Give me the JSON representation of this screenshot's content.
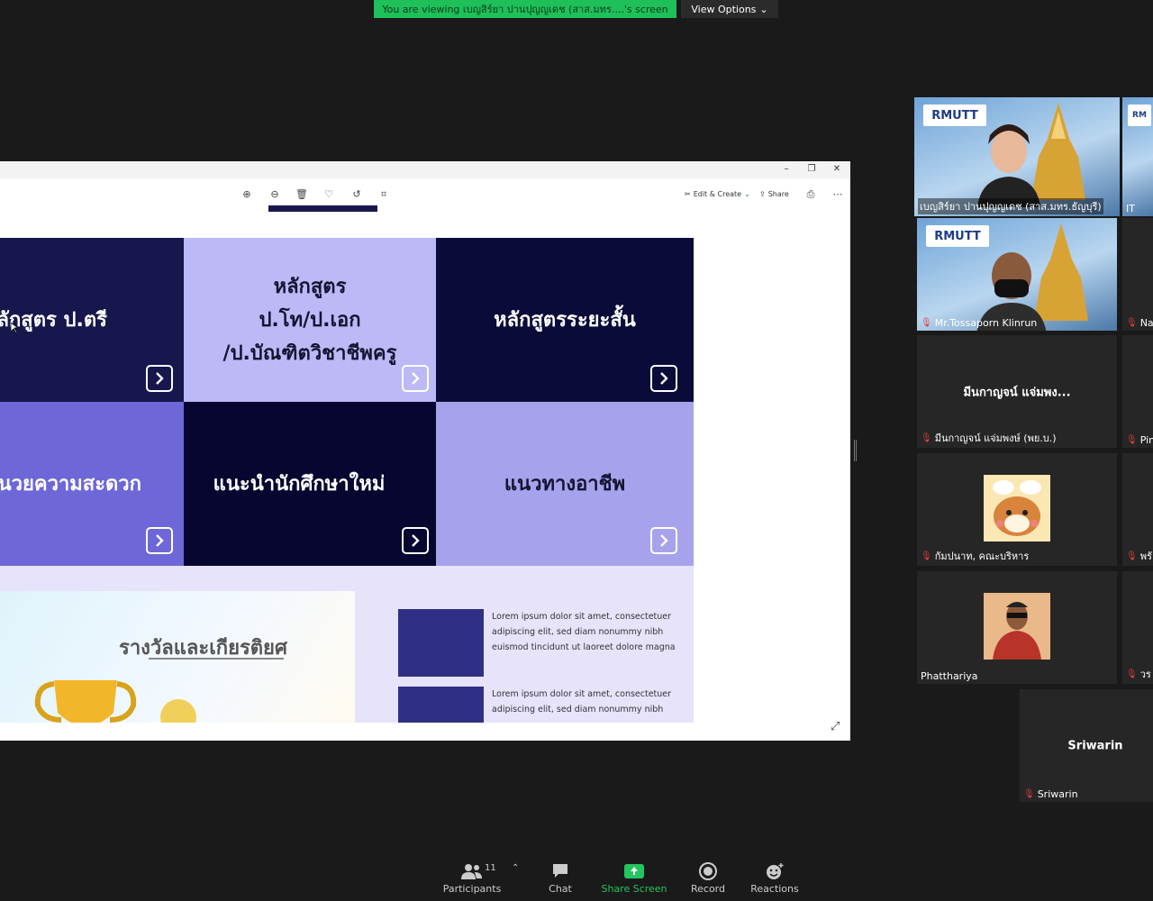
{
  "banner": {
    "viewing_text": "You are viewing เบญสิร์ยา ปานปุญญเดช (สาส.มทร....'s screen",
    "view_options_label": "View Options"
  },
  "shared_window": {
    "toolbar": {
      "edit_create_label": "Edit & Create",
      "share_label": "Share"
    },
    "tiles": [
      {
        "label": "หลักสูตร ป.ตรี",
        "bg": "#17174e",
        "fg": "#ffffff"
      },
      {
        "label_lines": [
          "หลักสูตร",
          "ป.โท/ป.เอก",
          "/ป.บัณฑิตวิชาชีพครู"
        ],
        "bg": "#bcb9f6",
        "fg": "#141432"
      },
      {
        "label": "หลักสูตรระยะสั้น",
        "bg": "#0b0b3a",
        "fg": "#ffffff"
      },
      {
        "label": "อำนวยความสะดวก",
        "bg": "#6d67d8",
        "fg": "#ffffff"
      },
      {
        "label": "แนะนำนักศึกษาใหม่",
        "bg": "#060630",
        "fg": "#ffffff"
      },
      {
        "label": "แนวทางอาชีพ",
        "bg": "#a7a2ec",
        "fg": "#141432"
      }
    ],
    "award_title": "รางวัลและเกียรติยศ",
    "news": [
      {
        "text": "Lorem ipsum dolor sit amet, consectetuer adipiscing elit, sed diam nonummy nibh euismod tincidunt ut laoreet dolore magna"
      },
      {
        "text": "Lorem ipsum dolor sit amet, consectetuer adipiscing elit, sed diam nonummy nibh"
      }
    ]
  },
  "gallery": {
    "participants": [
      {
        "name": "เบญสิร์ยา ปานปุญญเดช (สาส.มทร.ธัญบุรี)",
        "type": "video",
        "logo": "RMUTT",
        "active_speaker": true
      },
      {
        "name": "IT",
        "type": "video-partial",
        "logo": "RM"
      },
      {
        "name": "Mr.Tossaporn Klinrun",
        "type": "video",
        "logo": "RMUTT",
        "muted": true
      },
      {
        "name": "Na",
        "type": "partial",
        "muted": true
      },
      {
        "name": "มีนกาญจน์ แจ่มพงษ์ (พย.บ.)",
        "display": "มีนกาญจน์ แจ่มพง...",
        "type": "name",
        "muted": true
      },
      {
        "name": "Pin",
        "type": "partial",
        "muted": true
      },
      {
        "name": "กัมปนาท, คณะบริหาร",
        "type": "avatar",
        "muted": true
      },
      {
        "name": "พรั",
        "type": "partial",
        "muted": true
      },
      {
        "name": "Phatthariya",
        "type": "avatar",
        "muted": false
      },
      {
        "name": "วร",
        "type": "partial",
        "muted": true
      },
      {
        "name": "Sriwarin",
        "display": "Sriwarin",
        "type": "name",
        "muted": true
      }
    ]
  },
  "toolbar": {
    "participants_label": "Participants",
    "participants_count": "11",
    "chat_label": "Chat",
    "share_screen_label": "Share Screen",
    "record_label": "Record",
    "reactions_label": "Reactions"
  },
  "colors": {
    "share_green": "#22c55e",
    "banner_green": "#1fbf5a",
    "active_speaker": "#c5e05a",
    "muted_red": "#e0413b"
  }
}
